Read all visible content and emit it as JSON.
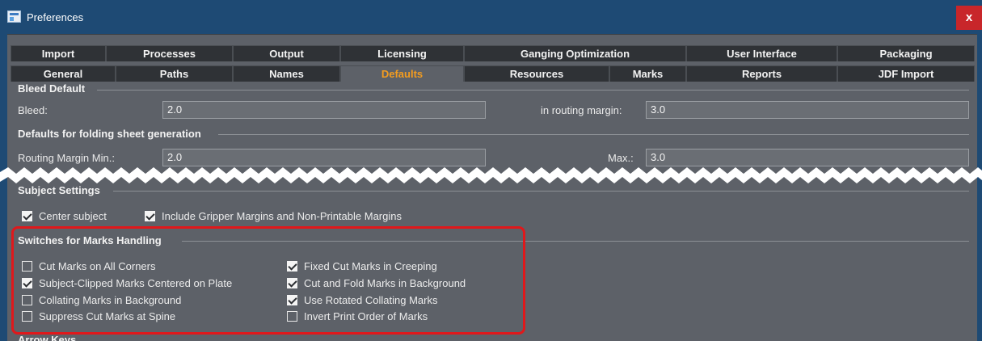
{
  "window": {
    "title": "Preferences",
    "close_label": "x"
  },
  "tabs": {
    "row1": [
      "Import",
      "Processes",
      "Output",
      "Licensing",
      "Ganging Optimization",
      "User Interface",
      "Packaging"
    ],
    "row2": [
      "General",
      "Paths",
      "Names",
      "Defaults",
      "Resources",
      "Marks",
      "Reports",
      "JDF Import"
    ],
    "active": "Defaults"
  },
  "bleed_default": {
    "title": "Bleed Default",
    "bleed_label": "Bleed:",
    "bleed_value": "2.0",
    "routing_label": "in routing margin:",
    "routing_value": "3.0"
  },
  "folding": {
    "title": "Defaults for folding sheet generation",
    "min_label": "Routing Margin Min.:",
    "min_value": "2.0",
    "max_label": "Max.:",
    "max_value": "3.0"
  },
  "subject": {
    "title": "Subject Settings",
    "options": [
      {
        "label": "Center subject",
        "checked": true
      },
      {
        "label": "Include Gripper Margins and Non-Printable Margins",
        "checked": true
      }
    ]
  },
  "marks": {
    "title": "Switches for Marks Handling",
    "left": [
      {
        "label": "Cut Marks on All Corners",
        "checked": false
      },
      {
        "label": "Subject-Clipped Marks Centered on Plate",
        "checked": true
      },
      {
        "label": "Collating Marks in Background",
        "checked": false
      },
      {
        "label": "Suppress Cut Marks at Spine",
        "checked": false
      }
    ],
    "right": [
      {
        "label": "Fixed Cut Marks in Creeping",
        "checked": true
      },
      {
        "label": "Cut and Fold Marks in Background",
        "checked": true
      },
      {
        "label": "Use Rotated Collating Marks",
        "checked": true
      },
      {
        "label": "Invert Print Order of Marks",
        "checked": false
      }
    ]
  },
  "next_section": {
    "title": "Arrow Keys"
  },
  "colors": {
    "titlebar": "#1e4a74",
    "panel": "#5d6168",
    "tab": "#2f3236",
    "active_tab_text": "#f39c1f",
    "highlight": "#e0181b",
    "close": "#c8262a"
  }
}
